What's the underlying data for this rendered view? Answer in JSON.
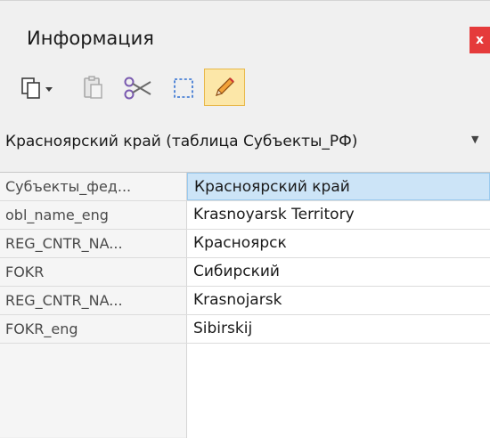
{
  "panel": {
    "title": "Информация",
    "close_label": "x",
    "close_color": "#e53b3b"
  },
  "toolbar": {
    "icons": [
      "copy-dropdown-icon",
      "paste-icon",
      "scissors-icon",
      "select-rectangle-icon",
      "pencil-icon"
    ],
    "active_tool": "pencil-icon"
  },
  "object_selector": {
    "value": "Красноярский край (таблица Субъекты_РФ)"
  },
  "attributes": [
    {
      "key": "Субъекты_фед...",
      "value": "Красноярский край"
    },
    {
      "key": "obl_name_eng",
      "value": "Krasnoyarsk Territory"
    },
    {
      "key": "REG_CNTR_NA...",
      "value": "Красноярск"
    },
    {
      "key": "FOKR",
      "value": "Сибирский"
    },
    {
      "key": "REG_CNTR_NA...",
      "value": "Krasnojarsk"
    },
    {
      "key": "FOKR_eng",
      "value": "Sibirskij"
    }
  ],
  "selection_color": "#cce4f7"
}
